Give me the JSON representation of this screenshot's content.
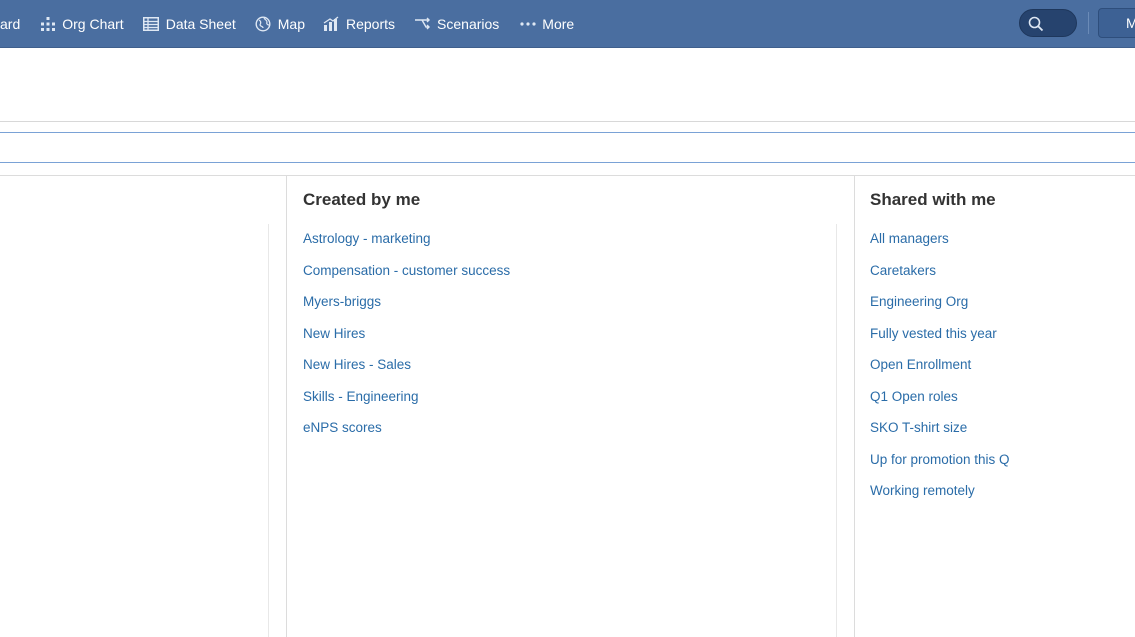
{
  "nav": {
    "items": [
      {
        "label": "ard",
        "icon": "dashboard-icon"
      },
      {
        "label": "Org Chart",
        "icon": "org-chart-icon"
      },
      {
        "label": "Data Sheet",
        "icon": "data-sheet-icon"
      },
      {
        "label": "Map",
        "icon": "globe-icon"
      },
      {
        "label": "Reports",
        "icon": "reports-icon"
      },
      {
        "label": "Scenarios",
        "icon": "scenarios-icon"
      },
      {
        "label": "More",
        "icon": "more-dots-icon"
      }
    ],
    "user_button_label": "M"
  },
  "created_by_me": {
    "title": "Created by me",
    "items": [
      "Astrology - marketing",
      "Compensation - customer success",
      "Myers-briggs",
      "New Hires",
      "New Hires - Sales",
      "Skills - Engineering",
      "eNPS scores"
    ]
  },
  "shared_with_me": {
    "title": "Shared with me",
    "items": [
      "All managers",
      "Caretakers",
      "Engineering Org",
      "Fully vested this year",
      "Open Enrollment",
      "Q1 Open roles",
      "SKO T-shirt size",
      "Up for promotion this Q",
      "Working remotely"
    ]
  },
  "colors": {
    "topbar": "#4a6ea0",
    "link": "#2a6ca8",
    "search_pill": "#26436e"
  }
}
